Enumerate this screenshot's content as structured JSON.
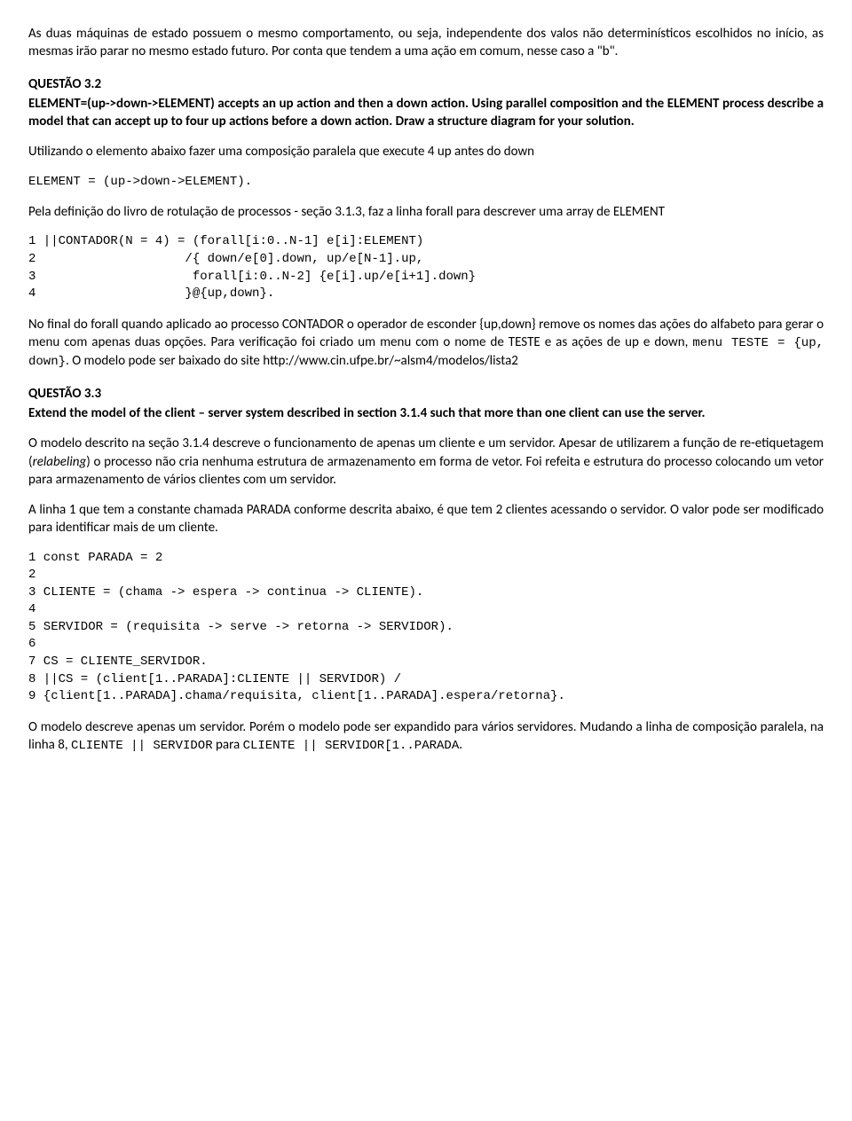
{
  "intro_p1": "As duas máquinas de estado possuem o mesmo comportamento, ou seja, independente dos valos não determinísticos escolhidos no início, as mesmas irão parar no mesmo estado futuro. Por conta que tendem a uma ação em comum, nesse caso a \"b\".",
  "q32_title": "QUESTÃO 3.2",
  "q32_text": "ELEMENT=(up->down->ELEMENT) accepts an up action and then a down action. Using parallel composition and the ELEMENT process describe a model that can accept up to four up actions before a down action. Draw a structure diagram for your solution.",
  "q32_p1": "Utilizando o elemento abaixo fazer uma composição paralela que execute 4 up antes do down",
  "q32_code1": "ELEMENT = (up->down->ELEMENT).",
  "q32_p2": "Pela definição do livro de rotulação de processos - seção 3.1.3, faz a linha forall para descrever uma array de ELEMENT",
  "q32_code2_l1": "1 ||CONTADOR(N = 4) = (forall[i:0..N-1] e[i]:ELEMENT)",
  "q32_code2_l2": "2                    /{ down/e[0].down, up/e[N-1].up,",
  "q32_code2_l3": "3                     forall[i:0..N-2] {e[i].up/e[i+1].down}",
  "q32_code2_l4": "4                    }@{up,down}.",
  "q32_p3_pre": "No final do forall quando aplicado ao processo CONTADOR o operador de esconder {up,down} remove os nomes das ações do alfabeto para gerar o menu com apenas duas opções. Para verificação foi criado um menu com o nome de TESTE e as ações de up e down, ",
  "q32_p3_code": "menu TESTE = {up, down}",
  "q32_p3_post": ". O modelo pode ser baixado do site http://www.cin.ufpe.br/~alsm4/modelos/lista2",
  "q33_title": "QUESTÃO 3.3",
  "q33_text": "Extend the model of the client – server system described in section 3.1.4 such that more than one client can use the server.",
  "q33_p1_pre": "O modelo descrito na seção 3.1.4 descreve o funcionamento de apenas um cliente e um servidor. Apesar de utilizarem a função de re-etiquetagem (",
  "q33_p1_italic": "relabeling",
  "q33_p1_post": ") o processo não cria nenhuma estrutura de armazenamento em forma de vetor. Foi refeita e estrutura do processo colocando um vetor para armazenamento de vários clientes com um servidor.",
  "q33_p2": "A linha 1 que tem a constante chamada PARADA conforme descrita abaixo, é que tem 2 clientes  acessando o servidor. O valor pode ser modificado para identificar mais de um cliente.",
  "q33_code_l1": "1 const PARADA = 2",
  "q33_code_l2": "2",
  "q33_code_l3": "3 CLIENTE = (chama -> espera -> continua -> CLIENTE).",
  "q33_code_l4": "4",
  "q33_code_l5": "5 SERVIDOR = (requisita -> serve -> retorna -> SERVIDOR).",
  "q33_code_l6": "6",
  "q33_code_l7": "7 CS = CLIENTE_SERVIDOR.",
  "q33_code_l8": "8 ||CS = (client[1..PARADA]:CLIENTE || SERVIDOR) /",
  "q33_code_l9": "9 {client[1..PARADA].chama/requisita, client[1..PARADA].espera/retorna}.",
  "q33_p3_pre": "O modelo  descreve apenas um servidor. Porém o modelo pode ser expandido para vários servidores. Mudando a linha de composição paralela, na linha 8, ",
  "q33_p3_code1": "CLIENTE || SERVIDOR",
  "q33_p3_mid": " para ",
  "q33_p3_code2": "CLIENTE || SERVIDOR[1..PARADA",
  "q33_p3_post": "."
}
